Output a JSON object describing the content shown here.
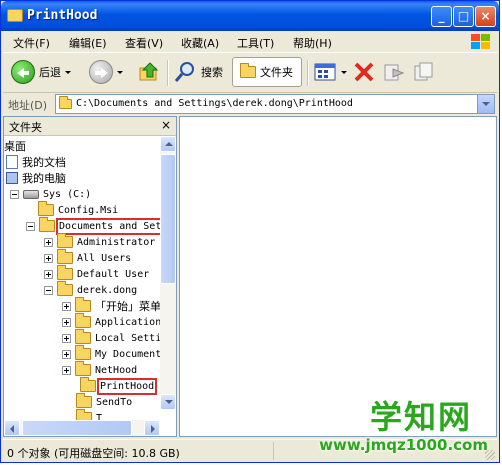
{
  "window": {
    "title": "PrintHood"
  },
  "menu": [
    {
      "key": "file",
      "label": "文件(F)"
    },
    {
      "key": "edit",
      "label": "编辑(E)"
    },
    {
      "key": "view",
      "label": "查看(V)"
    },
    {
      "key": "favorites",
      "label": "收藏(A)"
    },
    {
      "key": "tools",
      "label": "工具(T)"
    },
    {
      "key": "help",
      "label": "帮助(H)"
    }
  ],
  "toolbar": {
    "back_label": "后退",
    "search_label": "搜索",
    "folders_label": "文件夹"
  },
  "address": {
    "label": "地址(D)",
    "value": "C:\\Documents and Settings\\derek.dong\\PrintHood"
  },
  "folders_pane": {
    "title": "文件夹",
    "close": "×"
  },
  "tree": [
    {
      "label": "桌面",
      "expander": "",
      "icon": "desktop-icon"
    },
    {
      "label": "我的文档",
      "expander": "",
      "icon": "my-documents-icon"
    },
    {
      "label": "我的电脑",
      "expander": "",
      "icon": "my-computer-icon"
    },
    {
      "label": "Sys (C:)",
      "expander": "minus",
      "icon": "drive-icon"
    },
    {
      "label": "Config.Msi",
      "expander": "",
      "icon": "folder-icon"
    },
    {
      "label": "Documents and Set",
      "expander": "minus",
      "icon": "folder-open-icon",
      "highlight": true
    },
    {
      "label": "Administrator",
      "expander": "plus",
      "icon": "folder-icon"
    },
    {
      "label": "All Users",
      "expander": "plus",
      "icon": "folder-icon"
    },
    {
      "label": "Default User",
      "expander": "plus",
      "icon": "folder-icon"
    },
    {
      "label": "derek.dong",
      "expander": "minus",
      "icon": "folder-open-icon"
    },
    {
      "label": "「开始」菜单",
      "expander": "plus",
      "icon": "folder-icon"
    },
    {
      "label": "Application",
      "expander": "plus",
      "icon": "folder-icon"
    },
    {
      "label": "Local Setti",
      "expander": "plus",
      "icon": "folder-icon"
    },
    {
      "label": "My Document",
      "expander": "plus",
      "icon": "folder-icon"
    },
    {
      "label": "NetHood",
      "expander": "plus",
      "icon": "folder-icon"
    },
    {
      "label": "PrintHood",
      "expander": "",
      "icon": "folder-open-icon",
      "highlight": true
    },
    {
      "label": "SendTo",
      "expander": "",
      "icon": "folder-icon"
    },
    {
      "label": "T",
      "expander": "",
      "icon": "folder-icon"
    }
  ],
  "status": {
    "text": "0 个对象 (可用磁盘空间: 10.8 GB)"
  },
  "watermark": {
    "title": "学知网",
    "url": "www.jmqz1000.com"
  }
}
